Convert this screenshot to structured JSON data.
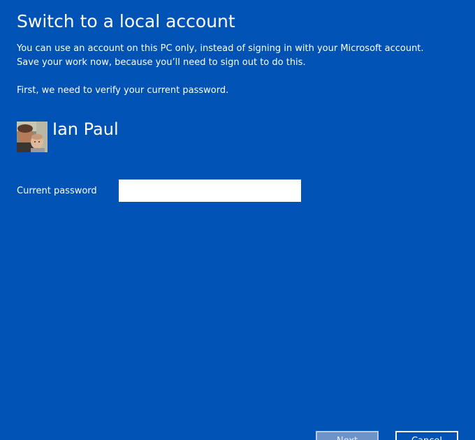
{
  "dialog": {
    "title": "Switch to a local account",
    "description_line1": "You can use an account on this PC only, instead of signing in with your Microsoft account.",
    "description_line2": "Save your work now, because you’ll need to sign out to do this.",
    "verify_prompt": "First, we need to verify your current password."
  },
  "user": {
    "name": "Ian Paul",
    "avatar_icon": "user-photo-icon"
  },
  "password": {
    "label": "Current password",
    "value": "",
    "placeholder": ""
  },
  "buttons": {
    "next_label": "Next",
    "cancel_label": "Cancel"
  },
  "colors": {
    "background": "#0052b4",
    "text": "#ffffff"
  }
}
